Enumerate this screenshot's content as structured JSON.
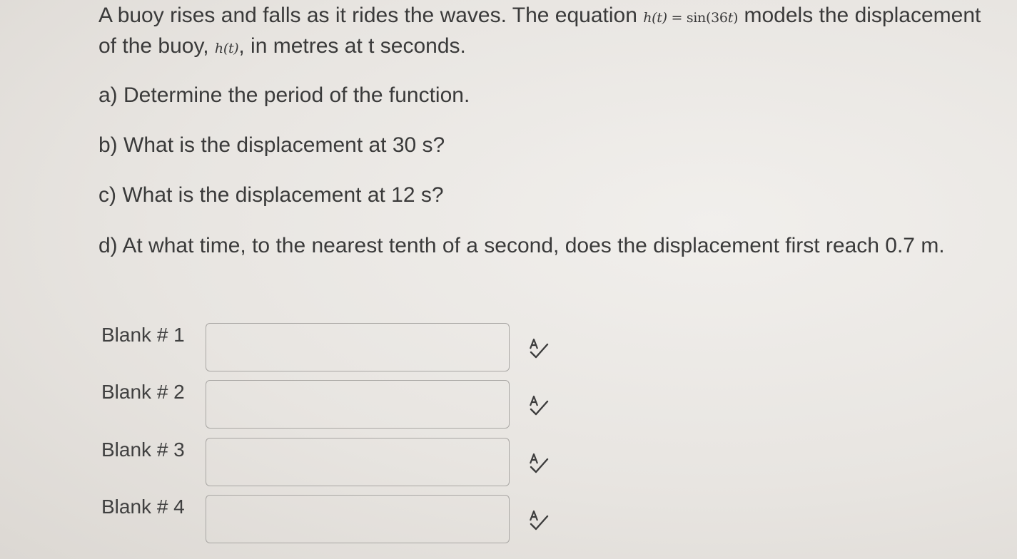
{
  "question": {
    "intro_before_eq": "A buoy rises and falls as it rides the waves.  The equation ",
    "eq_lhs": "h(t)",
    "eq_equals": " = ",
    "eq_rhs_func": "sin(36",
    "eq_rhs_var": "t",
    "eq_rhs_close": ")",
    "intro_after_eq": " models the displacement of the buoy, ",
    "inline_h": "h(t)",
    "intro_end": ", in metres at t seconds.",
    "parts": [
      "a) Determine the period of the function.",
      "b) What is the displacement at 30 s?",
      "c) What is the displacement at 12 s?",
      "d) At what time, to the nearest tenth of a second, does the displacement first reach 0.7 m."
    ]
  },
  "blanks": [
    {
      "label": "Blank # 1",
      "value": ""
    },
    {
      "label": "Blank # 2",
      "value": ""
    },
    {
      "label": "Blank # 3",
      "value": ""
    },
    {
      "label": "Blank # 4",
      "value": ""
    }
  ],
  "icons": {
    "spellcheck": "spellcheck-icon"
  },
  "colors": {
    "text": "#3a3a3a",
    "border": "#a9a7a4"
  }
}
